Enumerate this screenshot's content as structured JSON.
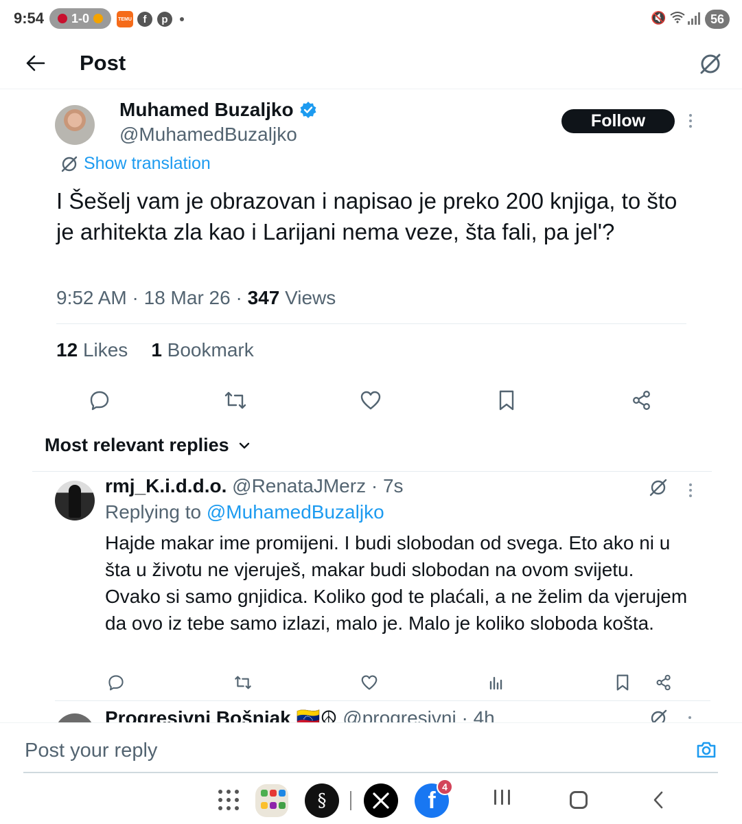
{
  "status_bar": {
    "time": "9:54",
    "score": "1-0",
    "temu": "TEMU",
    "battery": "56"
  },
  "header": {
    "title": "Post"
  },
  "post": {
    "author_name": "Muhamed Buzaljko",
    "author_handle": "@MuhamedBuzaljko",
    "follow_label": "Follow",
    "show_translation": "Show translation",
    "text": "I Šešelj vam je obrazovan i napisao je preko 200 knjiga, to što je arhitekta zla kao i Larijani nema veze, šta fali, pa jel'?",
    "time": "9:52 AM",
    "date": "18 Mar 26",
    "views_count": "347",
    "views_label": "Views",
    "likes_count": "12",
    "likes_label": "Likes",
    "bookmarks_count": "1",
    "bookmarks_label": "Bookmark"
  },
  "replies_section": {
    "title": "Most relevant replies"
  },
  "replies": [
    {
      "name": "rmj_K.i.d.d.o.",
      "handle": "@RenataJMerz",
      "time": "7s",
      "replying_to_label": "Replying to",
      "replying_to_handle": "@MuhamedBuzaljko",
      "text": "Hajde makar ime promijeni. I budi slobodan od svega. Eto ako ni u šta u životu ne vjeruješ, makar budi slobodan na ovom svijetu. Ovako si samo gnjidica. Koliko god te plaćali, a ne želim da vjerujem da ovo iz tebe samo izlazi, malo je. Malo je koliko sloboda košta."
    },
    {
      "name": "Progresivni Bošnjak 🇻🇪☮",
      "handle": "@progresivni",
      "time": "4h"
    }
  ],
  "composer": {
    "placeholder": "Post your reply"
  },
  "navbar": {
    "fb_badge": "4"
  },
  "colors": {
    "accent": "#1d9bf0",
    "text": "#0f1419",
    "secondary_text": "#536471",
    "divider": "#e6ecf0"
  }
}
